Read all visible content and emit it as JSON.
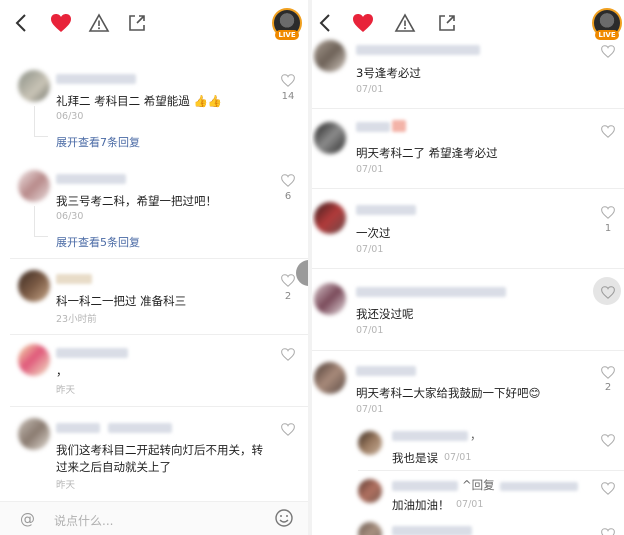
{
  "left": {
    "comments": [
      {
        "text": "礼拜二 考科目二  希望能過 👍👍",
        "time": "06/30",
        "likes": "14",
        "expand": "展开查看7条回复"
      },
      {
        "text": "我三号考二科，希望一把过吧！",
        "time": "06/30",
        "likes": "6",
        "expand": "展开查看5条回复"
      },
      {
        "text": "科一科二一把过   准备科三",
        "time": "23小时前",
        "likes": "2"
      },
      {
        "text": "，",
        "time": "昨天"
      },
      {
        "text_line1": "我们这考科目二开起转向灯后不用关，转",
        "text_line2": "过来之后自动就关上了",
        "time": "昨天"
      }
    ],
    "input_placeholder": "说点什么..."
  },
  "right": {
    "comments": [
      {
        "text": "3号逢考必过",
        "time": "07/01"
      },
      {
        "text": "明天考科二了 希望逢考必过",
        "time": "07/01"
      },
      {
        "text": "一次过",
        "time": "07/01",
        "likes": "1"
      },
      {
        "text": "我还没过呢",
        "time": "07/01"
      },
      {
        "text": "明天考科二大家给我鼓励一下好吧😊",
        "time": "07/01",
        "likes": "2"
      }
    ],
    "replies": [
      {
        "text": "我也是误",
        "time": "07/01",
        "tag": "，"
      },
      {
        "text": "加油加油！",
        "time": "07/01",
        "tag": "^回复"
      }
    ]
  },
  "topbar": {
    "live_label": "LIVE"
  },
  "colors": {
    "heart": "#e8233a",
    "link": "#4a6aa5",
    "live": "#f08a00"
  },
  "icons": [
    "back-arrow-icon",
    "heart-icon",
    "warning-icon",
    "share-icon",
    "like-heart-icon",
    "at-icon",
    "emoji-icon"
  ]
}
